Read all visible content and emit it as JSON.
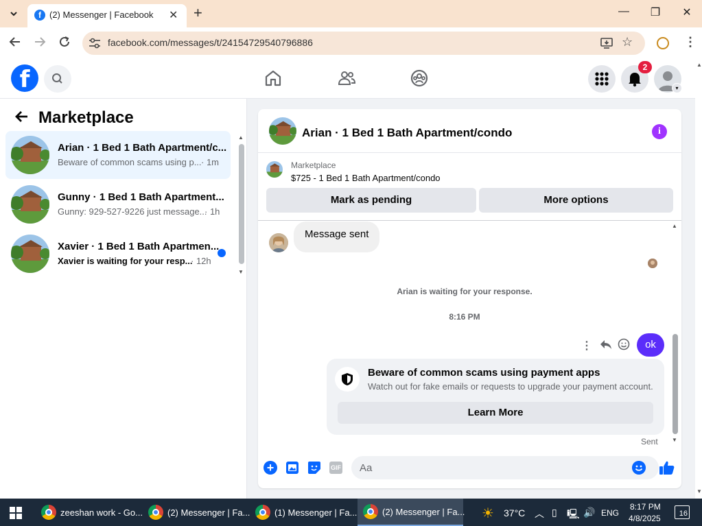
{
  "browser": {
    "tab_title": "(2) Messenger | Facebook",
    "url": "facebook.com/messages/t/24154729540796886"
  },
  "fb_nav": {
    "notification_count": "2"
  },
  "left_panel": {
    "title": "Marketplace",
    "conversations": [
      {
        "title": "Arian · 1 Bed 1 Bath Apartment/c...",
        "preview": "Beware of common scams using p...",
        "time": "· 1m",
        "unread": false,
        "active": true
      },
      {
        "title": "Gunny · 1 Bed 1 Bath Apartment...",
        "preview": "Gunny: 929-527-9226 just message...",
        "time": "· 1h",
        "unread": false,
        "active": false
      },
      {
        "title": "Xavier · 1 Bed 1 Bath Apartmen...",
        "preview": "Xavier is waiting for your resp...",
        "time": "· 12h",
        "unread": true,
        "active": false
      }
    ]
  },
  "chat": {
    "title": "Arian · 1 Bed 1 Bath Apartment/condo",
    "listing_section": "Marketplace",
    "listing_desc": "$725 - 1 Bed 1 Bath Apartment/condo",
    "mark_pending_label": "Mark as pending",
    "more_options_label": "More options",
    "message_received": "Message sent",
    "waiting_text": "Arian is waiting for your response.",
    "timestamp": "8:16 PM",
    "message_sent": "ok",
    "scam_title": "Beware of common scams using payment apps",
    "scam_desc": "Watch out for fake emails or requests to upgrade your payment account.",
    "learn_more_label": "Learn More",
    "sent_status": "Sent",
    "composer_placeholder": "Aa"
  },
  "colors": {
    "fb_blue": "#0866ff",
    "sent_bubble": "#5b2dfa",
    "info_purple": "#a033ff"
  },
  "taskbar": {
    "items": [
      {
        "label": "zeeshan work - Go..."
      },
      {
        "label": "(2) Messenger | Fa..."
      },
      {
        "label": "(1) Messenger | Fa..."
      },
      {
        "label": "(2) Messenger | Fa..."
      }
    ],
    "temperature": "37°C",
    "language": "ENG",
    "time": "8:17 PM",
    "date": "4/8/2025",
    "notification_count": "16"
  }
}
